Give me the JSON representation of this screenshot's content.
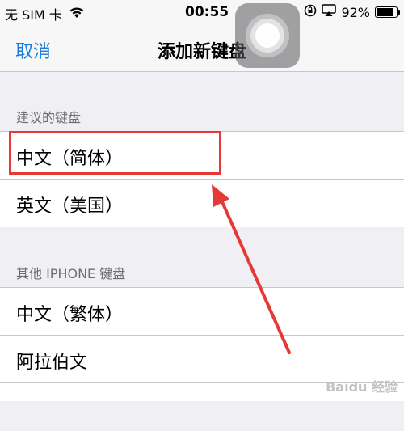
{
  "status_bar": {
    "carrier": "无 SIM 卡",
    "time": "00:55",
    "battery_percent": "92%",
    "battery_level": 0.92,
    "icons": [
      "wifi-icon",
      "orientation-lock-icon",
      "airplay-icon",
      "battery-icon"
    ]
  },
  "nav": {
    "cancel_label": "取消",
    "title": "添加新键盘"
  },
  "sections": [
    {
      "header": "建议的键盘",
      "items": [
        "中文（简体）",
        "英文（美国）"
      ]
    },
    {
      "header": "其他 IPHONE 键盘",
      "items": [
        "中文（繁体）",
        "阿拉伯文"
      ]
    }
  ],
  "annotation": {
    "highlight_color": "#e53935"
  },
  "watermark": "Baidu 经验"
}
